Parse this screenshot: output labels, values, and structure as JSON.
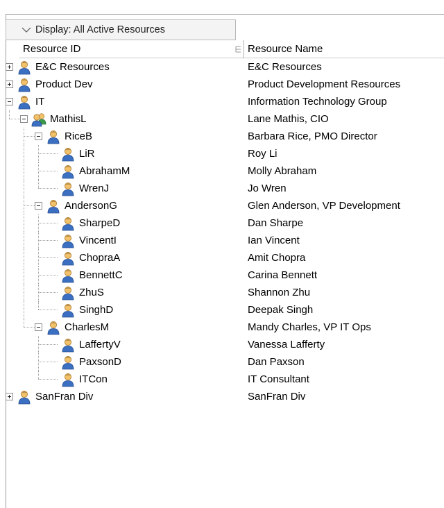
{
  "display": {
    "label": "Display: All Active Resources"
  },
  "columns": {
    "resource_id": "Resource ID",
    "resource_name": "Resource Name"
  },
  "rows": [
    {
      "id": "E&C Resources",
      "name": "E&C Resources",
      "level": 0,
      "toggle": "plus",
      "icon": "person-icon"
    },
    {
      "id": "Product Dev",
      "name": "Product Development Resources",
      "level": 0,
      "toggle": "plus",
      "icon": "person-icon"
    },
    {
      "id": "IT",
      "name": "Information Technology Group",
      "level": 0,
      "toggle": "minus",
      "icon": "person-icon"
    },
    {
      "id": "MathisL",
      "name": "Lane Mathis, CIO",
      "level": 1,
      "toggle": "minus",
      "icon": "group-icon"
    },
    {
      "id": "RiceB",
      "name": "Barbara Rice, PMO Director",
      "level": 2,
      "toggle": "minus",
      "icon": "person-icon"
    },
    {
      "id": "LiR",
      "name": "Roy Li",
      "level": 3,
      "toggle": "",
      "icon": "person-icon"
    },
    {
      "id": "AbrahamM",
      "name": "Molly Abraham",
      "level": 3,
      "toggle": "",
      "icon": "person-icon"
    },
    {
      "id": "WrenJ",
      "name": "Jo Wren",
      "level": 3,
      "toggle": "",
      "icon": "person-icon"
    },
    {
      "id": "AndersonG",
      "name": "Glen Anderson, VP Development",
      "level": 2,
      "toggle": "minus",
      "icon": "person-icon"
    },
    {
      "id": "SharpeD",
      "name": "Dan Sharpe",
      "level": 3,
      "toggle": "",
      "icon": "person-icon"
    },
    {
      "id": "VincentI",
      "name": "Ian Vincent",
      "level": 3,
      "toggle": "",
      "icon": "person-icon"
    },
    {
      "id": "ChopraA",
      "name": "Amit Chopra",
      "level": 3,
      "toggle": "",
      "icon": "person-icon"
    },
    {
      "id": "BennettC",
      "name": "Carina Bennett",
      "level": 3,
      "toggle": "",
      "icon": "person-icon"
    },
    {
      "id": "ZhuS",
      "name": "Shannon Zhu",
      "level": 3,
      "toggle": "",
      "icon": "person-icon"
    },
    {
      "id": "SinghD",
      "name": "Deepak Singh",
      "level": 3,
      "toggle": "",
      "icon": "person-icon"
    },
    {
      "id": "CharlesM",
      "name": "Mandy Charles, VP IT Ops",
      "level": 2,
      "toggle": "minus",
      "icon": "person-icon"
    },
    {
      "id": "LaffertyV",
      "name": "Vanessa Lafferty",
      "level": 3,
      "toggle": "",
      "icon": "person-icon"
    },
    {
      "id": "PaxsonD",
      "name": "Dan Paxson",
      "level": 3,
      "toggle": "",
      "icon": "person-icon"
    },
    {
      "id": "ITCon",
      "name": "IT Consultant",
      "level": 3,
      "toggle": "",
      "icon": "person-icon"
    },
    {
      "id": "SanFran Div",
      "name": "SanFran Div",
      "level": 0,
      "toggle": "plus",
      "icon": "person-icon"
    }
  ]
}
